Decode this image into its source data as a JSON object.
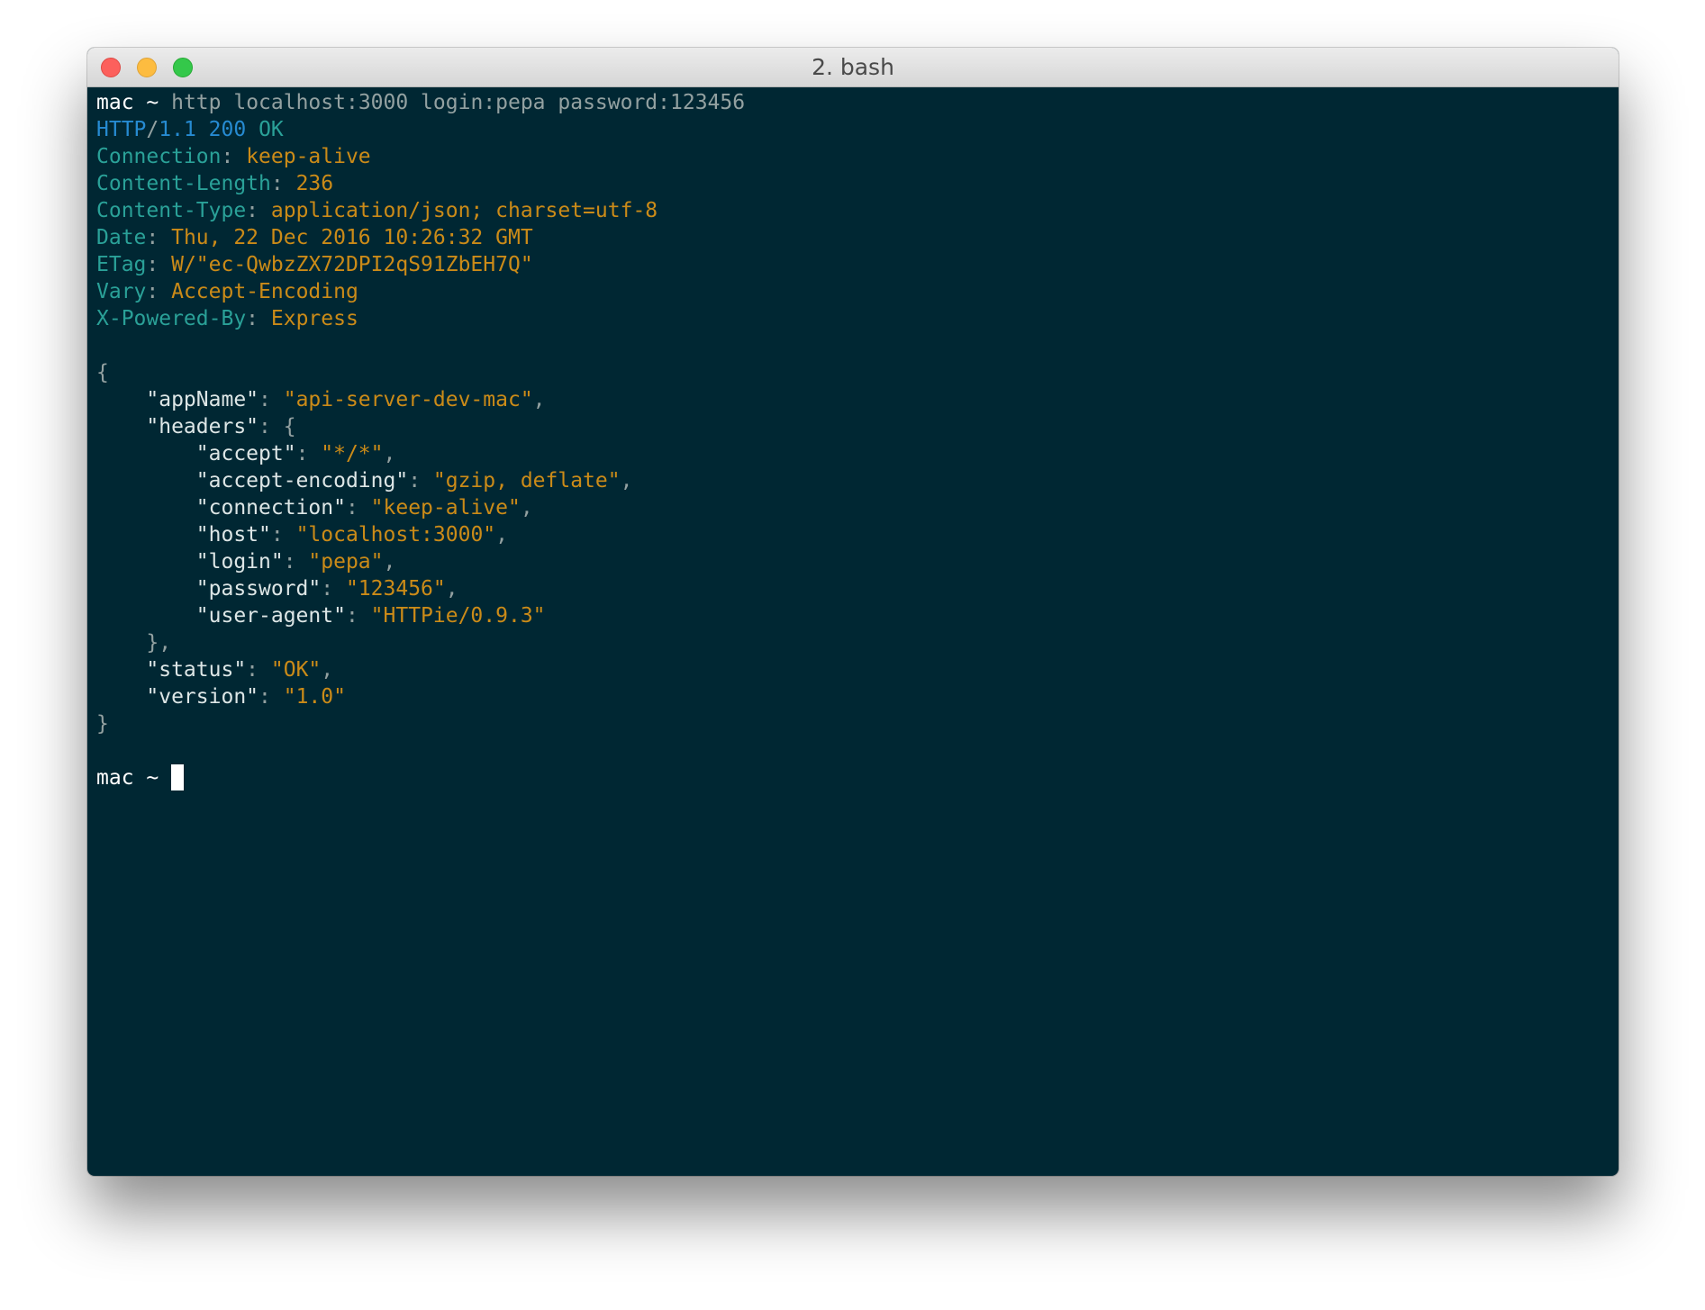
{
  "window": {
    "title": "2. bash"
  },
  "prompt": "mac ~",
  "command": "http localhost:3000 login:pepa password:123456",
  "status_line": {
    "protocol": "HTTP",
    "slash": "/",
    "version": "1.1",
    "code": "200",
    "reason": "OK"
  },
  "headers": [
    {
      "name": "Connection",
      "value": "keep-alive"
    },
    {
      "name": "Content-Length",
      "value": "236"
    },
    {
      "name": "Content-Type",
      "value": "application/json; charset=utf-8"
    },
    {
      "name": "Date",
      "value": "Thu, 22 Dec 2016 10:26:32 GMT"
    },
    {
      "name": "ETag",
      "value": "W/\"ec-QwbzZX72DPI2qS91ZbEH7Q\""
    },
    {
      "name": "Vary",
      "value": "Accept-Encoding"
    },
    {
      "name": "X-Powered-By",
      "value": "Express"
    }
  ],
  "body": {
    "open": "{",
    "close": "}",
    "appName": {
      "key": "\"appName\"",
      "value": "\"api-server-dev-mac\""
    },
    "headers_key": "\"headers\"",
    "headers_open": "{",
    "headers_close": "},",
    "headers_entries": [
      {
        "key": "\"accept\"",
        "value": "\"*/*\"",
        "comma": ","
      },
      {
        "key": "\"accept-encoding\"",
        "value": "\"gzip, deflate\"",
        "comma": ","
      },
      {
        "key": "\"connection\"",
        "value": "\"keep-alive\"",
        "comma": ","
      },
      {
        "key": "\"host\"",
        "value": "\"localhost:3000\"",
        "comma": ","
      },
      {
        "key": "\"login\"",
        "value": "\"pepa\"",
        "comma": ","
      },
      {
        "key": "\"password\"",
        "value": "\"123456\"",
        "comma": ","
      },
      {
        "key": "\"user-agent\"",
        "value": "\"HTTPie/0.9.3\"",
        "comma": ""
      }
    ],
    "status": {
      "key": "\"status\"",
      "value": "\"OK\""
    },
    "version": {
      "key": "\"version\"",
      "value": "\"1.0\""
    }
  },
  "colors": {
    "background": "#002733",
    "prompt": "#ffffff",
    "command": "#93a1a1",
    "header_name": "#2aa198",
    "header_value": "#cb8b18",
    "status_protocol": "#268bd2"
  }
}
